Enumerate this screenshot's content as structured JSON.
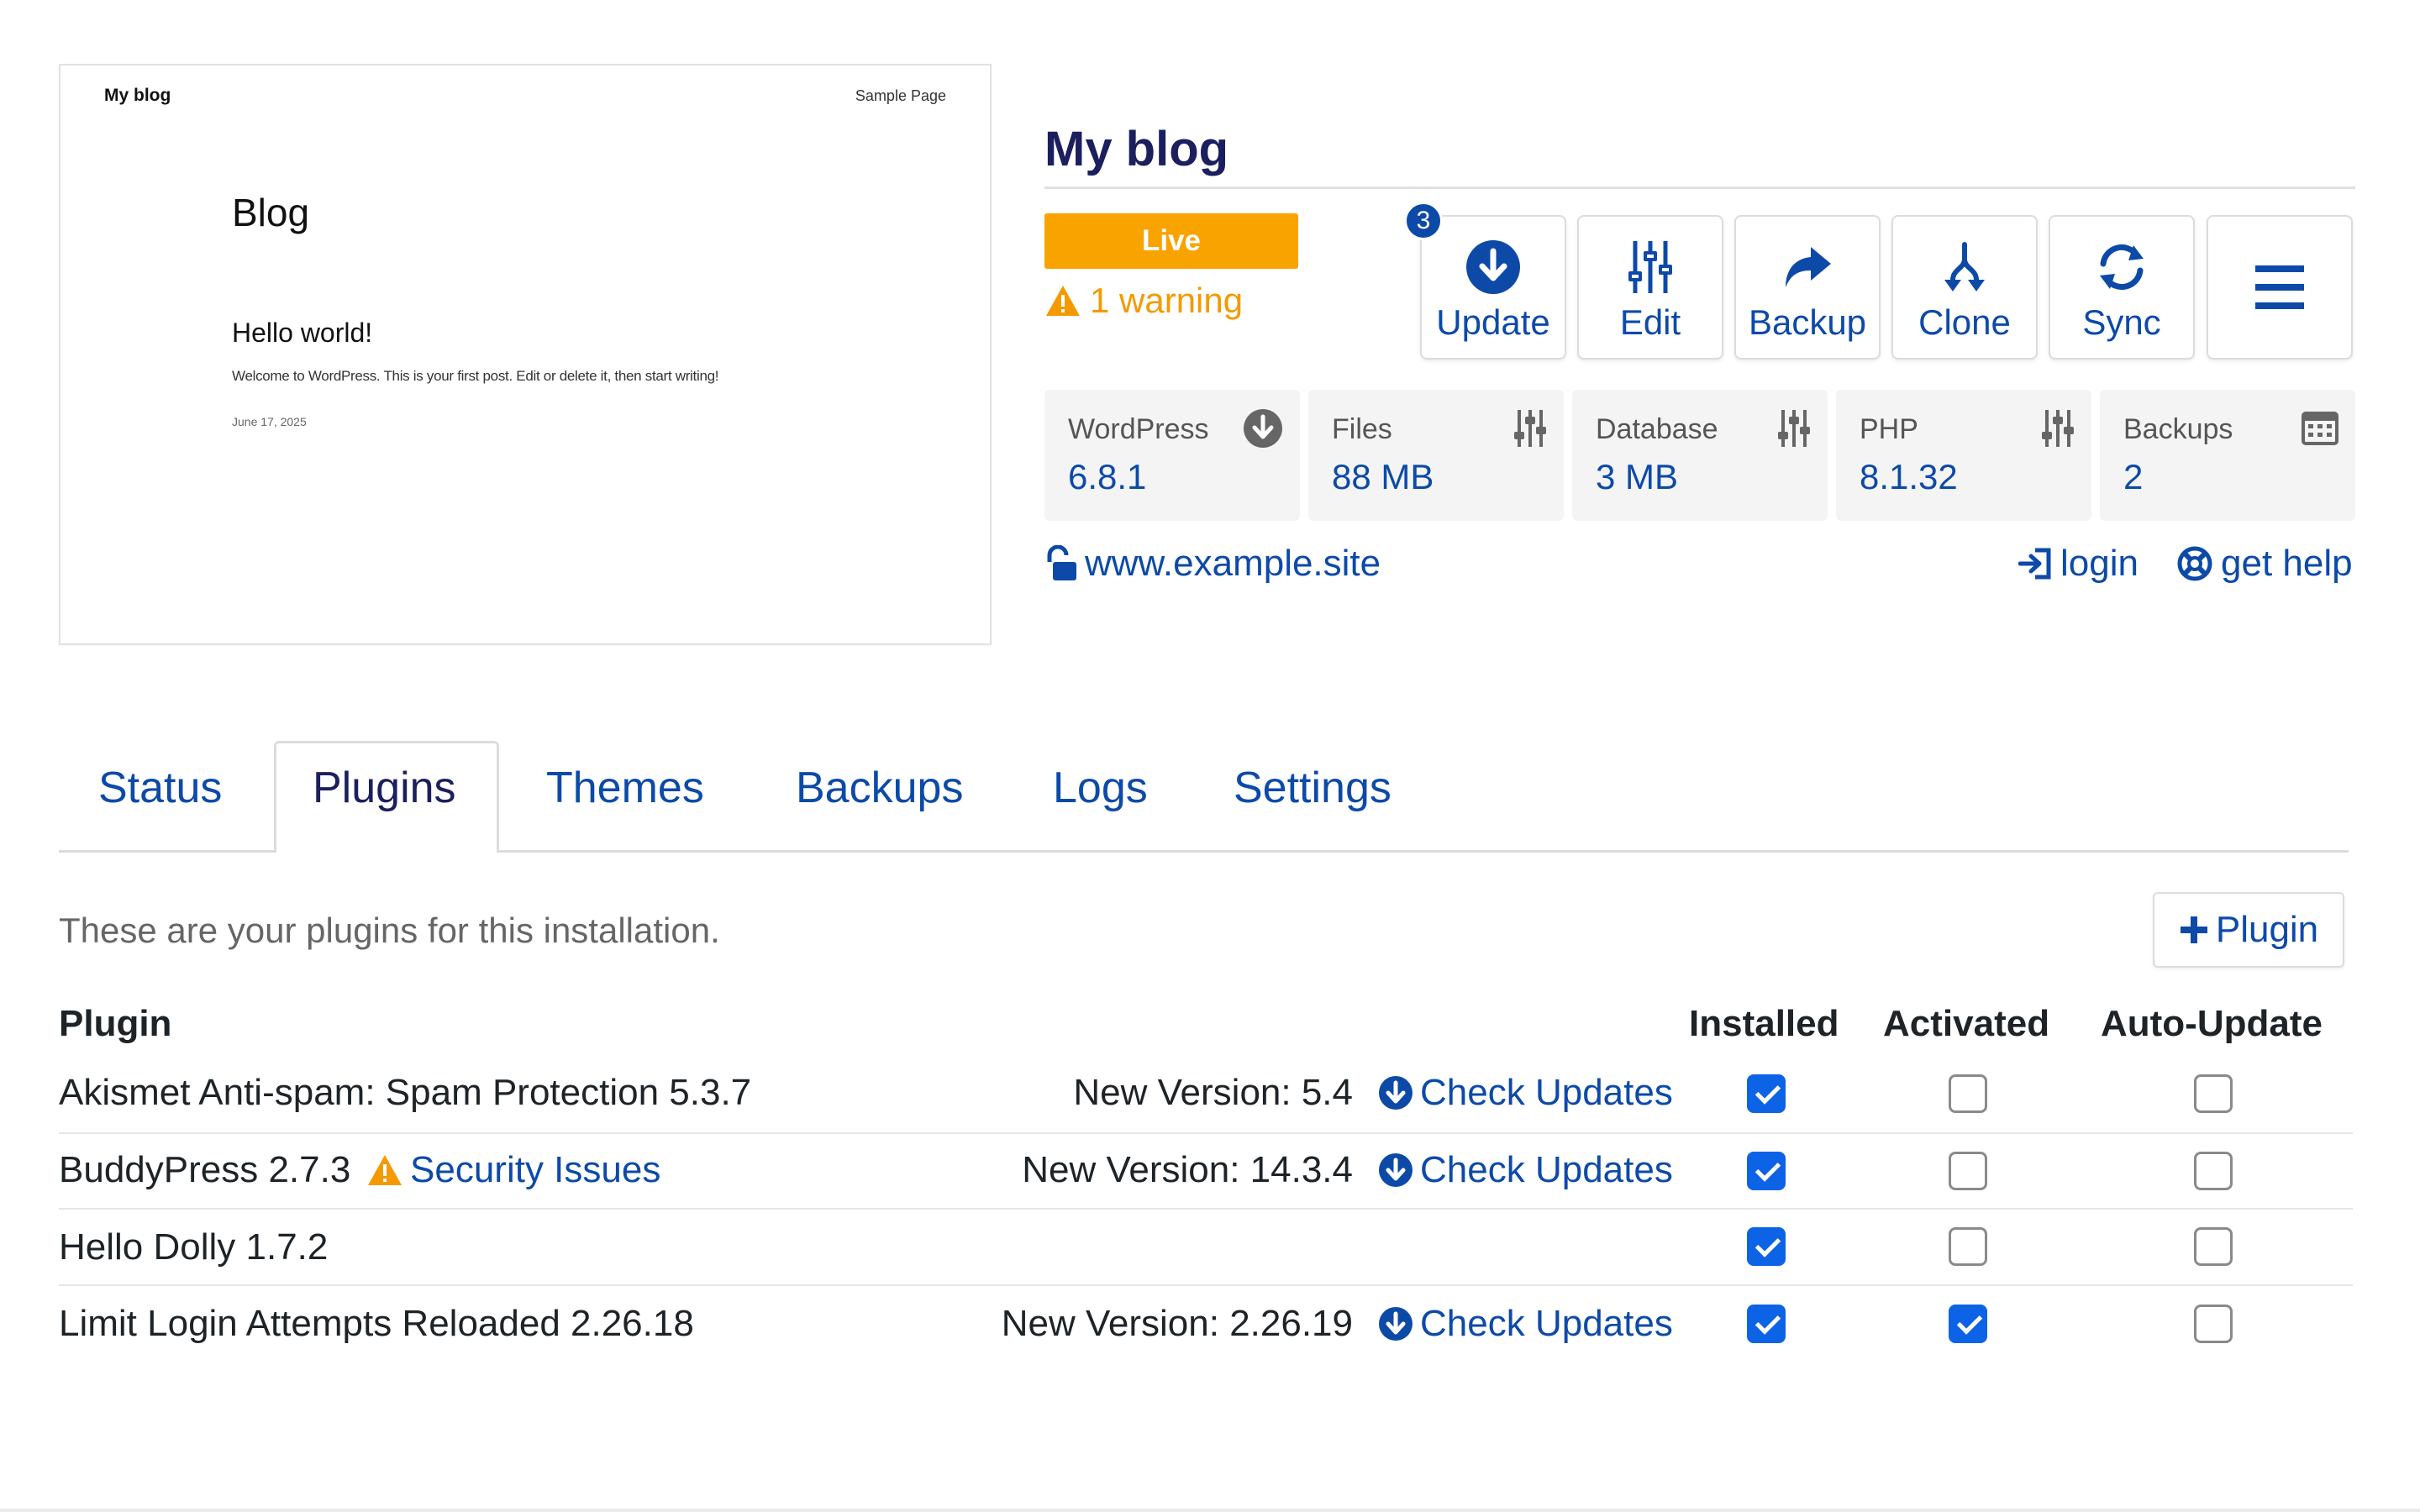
{
  "preview": {
    "brand": "My blog",
    "nav": "Sample Page",
    "title": "Blog",
    "post_title": "Hello world!",
    "excerpt": "Welcome to WordPress. This is your first post. Edit or delete it, then start writing!",
    "date": "June 17, 2025"
  },
  "site": {
    "title": "My blog",
    "status": "Live",
    "warning": "1 warning",
    "url": "www.example.site",
    "login": "login",
    "help": "get help"
  },
  "actions": {
    "update_count": "3",
    "update": "Update",
    "edit": "Edit",
    "backup": "Backup",
    "clone": "Clone",
    "sync": "Sync"
  },
  "info": {
    "wordpress": {
      "label": "WordPress",
      "value": "6.8.1"
    },
    "files": {
      "label": "Files",
      "value": "88 MB"
    },
    "database": {
      "label": "Database",
      "value": "3 MB"
    },
    "php": {
      "label": "PHP",
      "value": "8.1.32"
    },
    "backups": {
      "label": "Backups",
      "value": "2"
    }
  },
  "tabs": [
    "Status",
    "Plugins",
    "Themes",
    "Backups",
    "Logs",
    "Settings"
  ],
  "plugins_tab": {
    "intro": "These are your plugins for this installation.",
    "add_button": "Plugin",
    "headers": {
      "plugin": "Plugin",
      "installed": "Installed",
      "activated": "Activated",
      "auto_update": "Auto-Update"
    },
    "rows": [
      {
        "name": "Akismet Anti-spam: Spam Protection 5.3.7",
        "new_version": "New Version: 5.4",
        "check": "Check Updates",
        "installed": true,
        "activated": false,
        "auto_update": false
      },
      {
        "name": "BuddyPress 2.7.3",
        "security": "Security Issues",
        "new_version": "New Version: 14.3.4",
        "check": "Check Updates",
        "installed": true,
        "activated": false,
        "auto_update": false
      },
      {
        "name": "Hello Dolly 1.7.2",
        "installed": true,
        "activated": false,
        "auto_update": false
      },
      {
        "name": "Limit Login Attempts Reloaded 2.26.18",
        "new_version": "New Version: 2.26.19",
        "check": "Check Updates",
        "installed": true,
        "activated": true,
        "auto_update": false
      }
    ]
  },
  "colors": {
    "accent": "#0d4aa8",
    "live": "#f9a300",
    "warning": "#f49a00",
    "title": "#1b1f5e"
  }
}
